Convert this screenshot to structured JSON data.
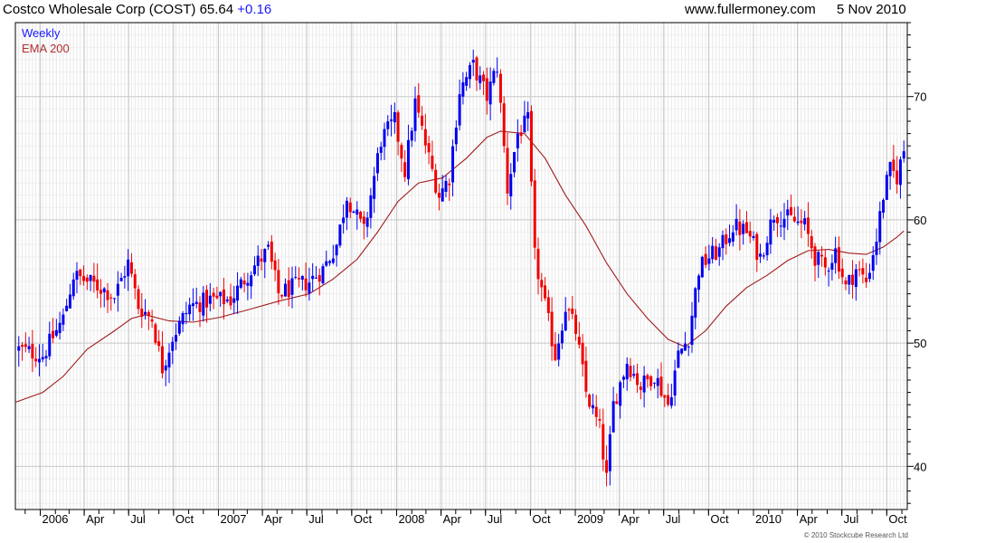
{
  "header": {
    "title": "Costco Wholesale Corp (COST)",
    "price": "65.64",
    "change": "+0.16",
    "site": "www.fullermoney.com",
    "date": "5 Nov 2010"
  },
  "legend": {
    "series1": "Weekly",
    "series2": "EMA 200"
  },
  "copyright": "© 2010 Stockcube Research Ltd",
  "colors": {
    "up": "#0000ee",
    "down": "#ee0000",
    "ema": "#a01c1c",
    "grid": "#d4d4d4"
  },
  "chart_data": {
    "type": "line",
    "y_axis_side": "right",
    "ylim": [
      36.5,
      76
    ],
    "xlim": [
      "2005-11-11",
      "2010-11-12"
    ],
    "grid": true,
    "x_ticks": [
      {
        "label": "2006",
        "date": "2006-01-01"
      },
      {
        "label": "Apr",
        "date": "2006-04-01"
      },
      {
        "label": "Jul",
        "date": "2006-07-01"
      },
      {
        "label": "Oct",
        "date": "2006-10-01"
      },
      {
        "label": "2007",
        "date": "2007-01-01"
      },
      {
        "label": "Apr",
        "date": "2007-04-01"
      },
      {
        "label": "Jul",
        "date": "2007-07-01"
      },
      {
        "label": "Oct",
        "date": "2007-10-01"
      },
      {
        "label": "2008",
        "date": "2008-01-01"
      },
      {
        "label": "Apr",
        "date": "2008-04-01"
      },
      {
        "label": "Jul",
        "date": "2008-07-01"
      },
      {
        "label": "Oct",
        "date": "2008-10-01"
      },
      {
        "label": "2009",
        "date": "2009-01-01"
      },
      {
        "label": "Apr",
        "date": "2009-04-01"
      },
      {
        "label": "Jul",
        "date": "2009-07-01"
      },
      {
        "label": "Oct",
        "date": "2009-10-01"
      },
      {
        "label": "2010",
        "date": "2010-01-01"
      },
      {
        "label": "Apr",
        "date": "2010-04-01"
      },
      {
        "label": "Jul",
        "date": "2010-07-01"
      },
      {
        "label": "Oct",
        "date": "2010-10-01"
      }
    ],
    "y_ticks": [
      40,
      50,
      60,
      70
    ],
    "series": [
      {
        "name": "Weekly",
        "style": "price",
        "points": [
          {
            "date": "2005-11-18",
            "value": 49.5
          },
          {
            "date": "2006-01-06",
            "value": 49.0
          },
          {
            "date": "2006-02-17",
            "value": 52.0
          },
          {
            "date": "2006-03-10",
            "value": 55.5
          },
          {
            "date": "2006-04-07",
            "value": 55.0
          },
          {
            "date": "2006-05-05",
            "value": 54.5
          },
          {
            "date": "2006-06-02",
            "value": 53.8
          },
          {
            "date": "2006-06-30",
            "value": 56.5
          },
          {
            "date": "2006-07-21",
            "value": 53.0
          },
          {
            "date": "2006-08-18",
            "value": 52.0
          },
          {
            "date": "2006-09-08",
            "value": 48.0
          },
          {
            "date": "2006-09-29",
            "value": 50.5
          },
          {
            "date": "2006-11-03",
            "value": 53.0
          },
          {
            "date": "2006-12-15",
            "value": 53.5
          },
          {
            "date": "2007-01-26",
            "value": 53.5
          },
          {
            "date": "2007-03-09",
            "value": 56.0
          },
          {
            "date": "2007-04-13",
            "value": 57.5
          },
          {
            "date": "2007-05-04",
            "value": 54.0
          },
          {
            "date": "2007-06-01",
            "value": 54.5
          },
          {
            "date": "2007-07-06",
            "value": 55.0
          },
          {
            "date": "2007-08-03",
            "value": 56.0
          },
          {
            "date": "2007-08-31",
            "value": 58.0
          },
          {
            "date": "2007-09-21",
            "value": 62.0
          },
          {
            "date": "2007-10-26",
            "value": 59.0
          },
          {
            "date": "2007-11-09",
            "value": 62.0
          },
          {
            "date": "2007-11-30",
            "value": 66.5
          },
          {
            "date": "2007-12-28",
            "value": 68.0
          },
          {
            "date": "2008-01-18",
            "value": 64.0
          },
          {
            "date": "2008-02-08",
            "value": 69.5
          },
          {
            "date": "2008-03-07",
            "value": 65.0
          },
          {
            "date": "2008-03-28",
            "value": 62.0
          },
          {
            "date": "2008-04-18",
            "value": 63.5
          },
          {
            "date": "2008-05-09",
            "value": 70.5
          },
          {
            "date": "2008-06-06",
            "value": 72.5
          },
          {
            "date": "2008-07-04",
            "value": 70.0
          },
          {
            "date": "2008-07-25",
            "value": 72.5
          },
          {
            "date": "2008-08-15",
            "value": 62.5
          },
          {
            "date": "2008-09-05",
            "value": 67.0
          },
          {
            "date": "2008-09-26",
            "value": 68.0
          },
          {
            "date": "2008-10-10",
            "value": 57.0
          },
          {
            "date": "2008-10-31",
            "value": 53.0
          },
          {
            "date": "2008-11-21",
            "value": 49.0
          },
          {
            "date": "2008-12-12",
            "value": 53.0
          },
          {
            "date": "2009-01-02",
            "value": 51.0
          },
          {
            "date": "2009-01-23",
            "value": 46.0
          },
          {
            "date": "2009-02-20",
            "value": 43.0
          },
          {
            "date": "2009-03-06",
            "value": 39.0
          },
          {
            "date": "2009-03-20",
            "value": 45.0
          },
          {
            "date": "2009-04-17",
            "value": 48.5
          },
          {
            "date": "2009-05-15",
            "value": 46.5
          },
          {
            "date": "2009-06-12",
            "value": 47.5
          },
          {
            "date": "2009-07-10",
            "value": 45.0
          },
          {
            "date": "2009-07-31",
            "value": 49.0
          },
          {
            "date": "2009-08-21",
            "value": 50.5
          },
          {
            "date": "2009-09-11",
            "value": 56.0
          },
          {
            "date": "2009-10-02",
            "value": 57.0
          },
          {
            "date": "2009-10-23",
            "value": 57.5
          },
          {
            "date": "2009-11-20",
            "value": 59.5
          },
          {
            "date": "2009-12-18",
            "value": 59.0
          },
          {
            "date": "2010-01-15",
            "value": 57.0
          },
          {
            "date": "2010-02-12",
            "value": 60.5
          },
          {
            "date": "2010-03-19",
            "value": 60.0
          },
          {
            "date": "2010-04-16",
            "value": 59.5
          },
          {
            "date": "2010-05-07",
            "value": 57.0
          },
          {
            "date": "2010-05-28",
            "value": 56.0
          },
          {
            "date": "2010-06-18",
            "value": 57.5
          },
          {
            "date": "2010-07-09",
            "value": 54.5
          },
          {
            "date": "2010-07-30",
            "value": 56.0
          },
          {
            "date": "2010-08-20",
            "value": 55.0
          },
          {
            "date": "2010-09-10",
            "value": 58.5
          },
          {
            "date": "2010-09-24",
            "value": 62.0
          },
          {
            "date": "2010-10-08",
            "value": 64.0
          },
          {
            "date": "2010-10-22",
            "value": 63.5
          },
          {
            "date": "2010-11-05",
            "value": 65.64
          }
        ]
      },
      {
        "name": "EMA 200",
        "style": "ema",
        "points": [
          {
            "date": "2005-11-11",
            "value": 45.2
          },
          {
            "date": "2006-01-06",
            "value": 46.0
          },
          {
            "date": "2006-02-17",
            "value": 47.3
          },
          {
            "date": "2006-04-07",
            "value": 49.5
          },
          {
            "date": "2006-06-02",
            "value": 51.0
          },
          {
            "date": "2006-07-07",
            "value": 52.0
          },
          {
            "date": "2006-08-04",
            "value": 52.3
          },
          {
            "date": "2006-09-22",
            "value": 51.8
          },
          {
            "date": "2006-11-10",
            "value": 51.7
          },
          {
            "date": "2007-01-05",
            "value": 52.1
          },
          {
            "date": "2007-03-02",
            "value": 52.7
          },
          {
            "date": "2007-05-04",
            "value": 53.4
          },
          {
            "date": "2007-07-06",
            "value": 54.0
          },
          {
            "date": "2007-08-24",
            "value": 55.2
          },
          {
            "date": "2007-10-12",
            "value": 56.8
          },
          {
            "date": "2007-11-23",
            "value": 59.0
          },
          {
            "date": "2008-01-04",
            "value": 61.5
          },
          {
            "date": "2008-02-15",
            "value": 63.0
          },
          {
            "date": "2008-04-04",
            "value": 63.4
          },
          {
            "date": "2008-05-23",
            "value": 65.0
          },
          {
            "date": "2008-07-04",
            "value": 66.7
          },
          {
            "date": "2008-08-01",
            "value": 67.2
          },
          {
            "date": "2008-09-19",
            "value": 67.0
          },
          {
            "date": "2008-10-31",
            "value": 65.0
          },
          {
            "date": "2008-12-12",
            "value": 62.0
          },
          {
            "date": "2009-01-23",
            "value": 59.5
          },
          {
            "date": "2009-03-06",
            "value": 56.5
          },
          {
            "date": "2009-04-17",
            "value": 54.0
          },
          {
            "date": "2009-05-29",
            "value": 52.0
          },
          {
            "date": "2009-07-10",
            "value": 50.3
          },
          {
            "date": "2009-08-14",
            "value": 49.7
          },
          {
            "date": "2009-09-25",
            "value": 51.0
          },
          {
            "date": "2009-11-06",
            "value": 53.0
          },
          {
            "date": "2009-12-18",
            "value": 54.5
          },
          {
            "date": "2010-01-29",
            "value": 55.5
          },
          {
            "date": "2010-03-12",
            "value": 56.7
          },
          {
            "date": "2010-04-23",
            "value": 57.5
          },
          {
            "date": "2010-06-04",
            "value": 57.6
          },
          {
            "date": "2010-07-16",
            "value": 57.3
          },
          {
            "date": "2010-08-20",
            "value": 57.2
          },
          {
            "date": "2010-09-24",
            "value": 57.8
          },
          {
            "date": "2010-10-22",
            "value": 58.6
          },
          {
            "date": "2010-11-05",
            "value": 59.1
          }
        ]
      }
    ]
  }
}
